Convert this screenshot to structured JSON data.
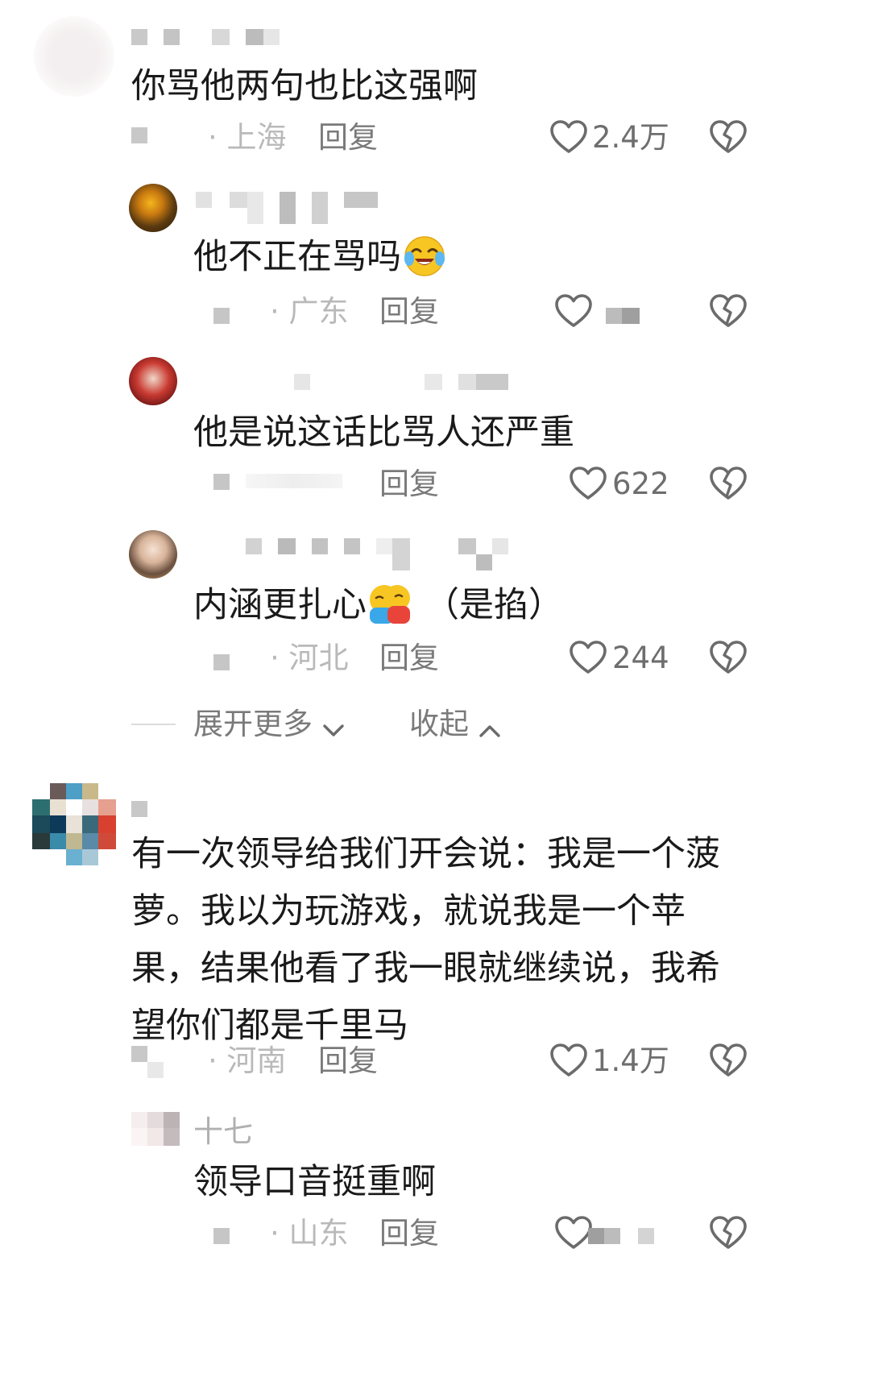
{
  "comments": [
    {
      "text": "你骂他两句也比这强啊",
      "location": "· 上海",
      "reply_label": "回复",
      "likes": "2.4万",
      "replies": [
        {
          "text": "他不正在骂吗",
          "emoji": "crying-laughing-emoji",
          "location": "· 广东",
          "reply_label": "回复",
          "likes": ""
        },
        {
          "text": "他是说这话比骂人还严重",
          "location": "",
          "reply_label": "回复",
          "likes": "622"
        },
        {
          "text": "内涵更扎心",
          "emoji": "hugging-emoji",
          "text_suffix": "（是掐）",
          "location": "· 河北",
          "reply_label": "回复",
          "likes": "244"
        }
      ],
      "expand_label": "展开更多",
      "collapse_label": "收起"
    },
    {
      "text": "有一次领导给我们开会说：我是一个菠萝。我以为玩游戏，就说我是一个苹果，结果他看了我一眼就继续说，我希望你们都是千里马",
      "location": "· 河南",
      "reply_label": "回复",
      "likes": "1.4万",
      "replies": [
        {
          "username": "十七",
          "text": "领导口音挺重啊",
          "location": "· 山东",
          "reply_label": "回复",
          "likes": ""
        }
      ]
    }
  ],
  "icons": {
    "like": "heart-outline-icon",
    "dislike": "broken-heart-icon",
    "expand": "chevron-down-icon",
    "collapse": "chevron-up-icon"
  },
  "colors": {
    "text": "#1a1a1a",
    "location": "#b9b9b9",
    "reply": "#7a7a7a",
    "like_count": "#6e6e6e",
    "icon": "#6b6b6b"
  }
}
